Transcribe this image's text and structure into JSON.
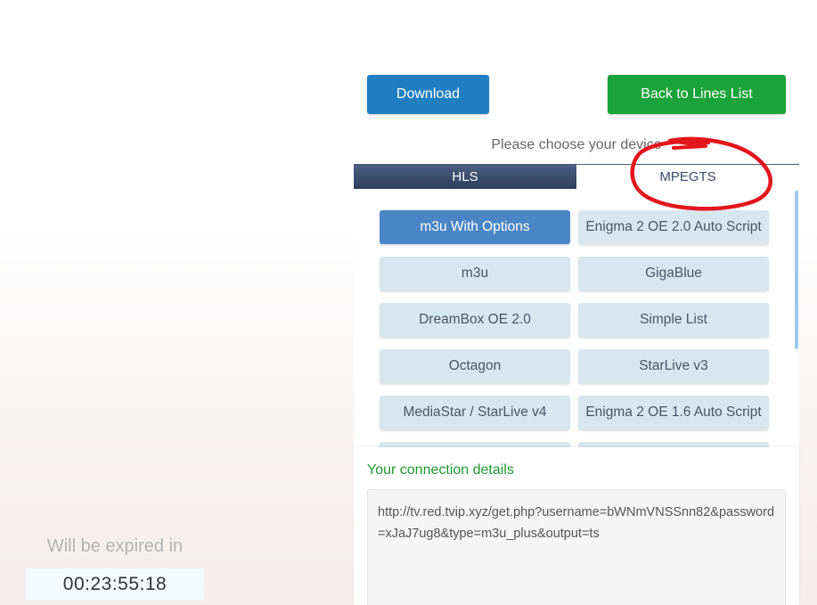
{
  "toolbar": {
    "download_label": "Download",
    "back_label": "Back to Lines List"
  },
  "device_panel": {
    "title": "Please choose your device",
    "tabs": [
      {
        "label": "HLS",
        "active": true
      },
      {
        "label": "MPEGTS",
        "active": false
      }
    ],
    "devices": [
      {
        "label": "m3u With Options",
        "selected": true
      },
      {
        "label": "Enigma 2 OE 2.0 Auto Script",
        "selected": false
      },
      {
        "label": "m3u",
        "selected": false
      },
      {
        "label": "GigaBlue",
        "selected": false
      },
      {
        "label": "DreamBox OE 2.0",
        "selected": false
      },
      {
        "label": "Simple List",
        "selected": false
      },
      {
        "label": "Octagon",
        "selected": false
      },
      {
        "label": "StarLive v3",
        "selected": false
      },
      {
        "label": "MediaStar / StarLive v4",
        "selected": false
      },
      {
        "label": "Enigma 2 OE 1.6 Auto Script",
        "selected": false
      }
    ]
  },
  "connection": {
    "title": "Your connection details",
    "url": "http://tv.red.tvip.xyz/get.php?username=bWNmVNSSnn82&password=xJaJ7ug8&type=m3u_plus&output=ts"
  },
  "expiry": {
    "label": "Will be expired in",
    "time": "00:23:55:18"
  },
  "colors": {
    "primary_blue": "#1f7fc0",
    "success_green": "#1aa33a",
    "tab_active": "#2d3e5a",
    "device_selected": "#4a86c5",
    "device_bg": "#d7e7f0",
    "annotation_red": "#e3161c"
  }
}
